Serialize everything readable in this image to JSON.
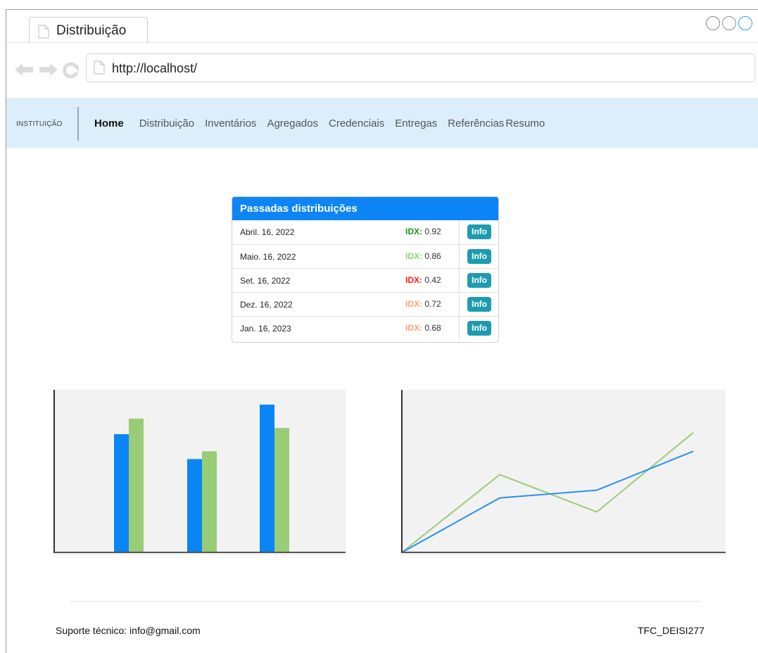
{
  "browser": {
    "tab_title": "Distribuição",
    "url": "http://localhost/"
  },
  "nav": {
    "brand": "INSTITUIÇÃO",
    "items": [
      {
        "label": "Home",
        "active": true
      },
      {
        "label": "Distribuição"
      },
      {
        "label": "Inventários"
      },
      {
        "label": "Agregados"
      },
      {
        "label": "Credenciais"
      },
      {
        "label": "Entregas"
      },
      {
        "label": "Referências"
      },
      {
        "label": "Resumo"
      }
    ]
  },
  "panel": {
    "title": "Passadas distribuições",
    "rows": [
      {
        "date": "Abril. 16, 2022",
        "idx_label": "IDX:",
        "idx_value": "0.92",
        "idx_color": "#1a9a1a",
        "button": "Info"
      },
      {
        "date": "Maio. 16, 2022",
        "idx_label": "IDX:",
        "idx_value": "0.86",
        "idx_color": "#8fd07a",
        "button": "Info"
      },
      {
        "date": "Set. 16, 2022",
        "idx_label": "IDX:",
        "idx_value": "0.42",
        "idx_color": "#ff1a1a",
        "button": "Info"
      },
      {
        "date": "Dez. 16, 2022",
        "idx_label": "IDX:",
        "idx_value": "0.72",
        "idx_color": "#f5a37a",
        "button": "Info"
      },
      {
        "date": "Jan. 16, 2023",
        "idx_label": "IDX:",
        "idx_value": "0.68",
        "idx_color": "#f5a37a",
        "button": "Info"
      }
    ]
  },
  "chart_data": [
    {
      "type": "bar",
      "categories": [
        "",
        "",
        ""
      ],
      "series": [
        {
          "values": [
            76,
            60,
            95
          ]
        },
        {
          "values": [
            86,
            65,
            80
          ]
        }
      ],
      "colors": [
        "#0a85f5",
        "#99cc77"
      ],
      "ylim": [
        0,
        100
      ],
      "grid": false
    },
    {
      "type": "line",
      "x": [
        0,
        1,
        2,
        3
      ],
      "series": [
        {
          "values": [
            0,
            35,
            40,
            65
          ]
        },
        {
          "values": [
            0,
            50,
            26,
            77
          ]
        }
      ],
      "colors": [
        "#2a8ef5",
        "#99cc77"
      ],
      "ylim": [
        0,
        100
      ],
      "grid": false
    }
  ],
  "footer": {
    "support": "Suporte técnico: info@gmail.com",
    "project": "TFC_DEISI277"
  },
  "colors": {
    "primary": "#0d85f5",
    "nav_bg": "#dbeefa",
    "info_button": "#1e9bb0",
    "chart_bg": "#f2f2f2"
  },
  "icons": [
    "page-icon",
    "back-arrow-icon",
    "forward-arrow-icon",
    "reload-icon"
  ]
}
